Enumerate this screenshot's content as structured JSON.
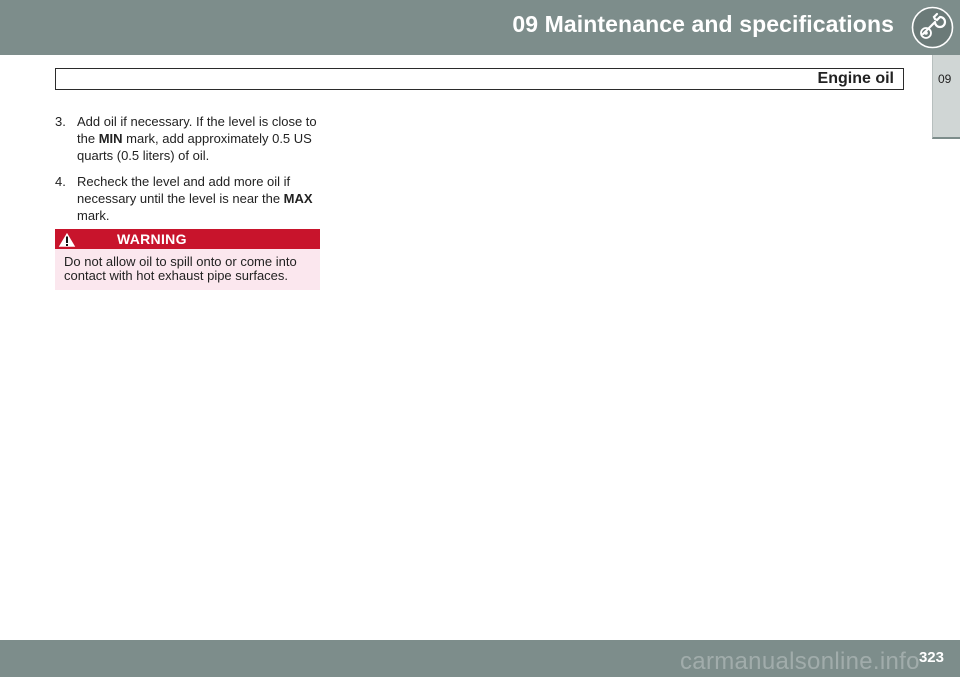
{
  "header": {
    "chapter_title": "09 Maintenance and specifications",
    "icon": "wrench-gear-icon"
  },
  "side_tab": {
    "label": "09"
  },
  "section": {
    "title": "Engine oil"
  },
  "steps": [
    {
      "number": "3.",
      "text_before": "Add oil if necessary. If the level is close to the ",
      "bold": "MIN",
      "text_after": " mark, add approximately 0.5 US quarts (0.5 liters) of oil."
    },
    {
      "number": "4.",
      "text_before": "Recheck the level and add more oil if necessary until the level is near the ",
      "bold": "MAX",
      "text_after": " mark."
    }
  ],
  "warning": {
    "label": "WARNING",
    "icon": "warning-triangle-icon",
    "text": "Do not allow oil to spill onto or come into contact with hot exhaust pipe surfaces."
  },
  "footer": {
    "page_number": "323",
    "watermark": "carmanualsonline.info"
  },
  "colors": {
    "band": "#7d8d8b",
    "warning_red": "#c8142c",
    "warning_bg": "#fbe7ee"
  }
}
